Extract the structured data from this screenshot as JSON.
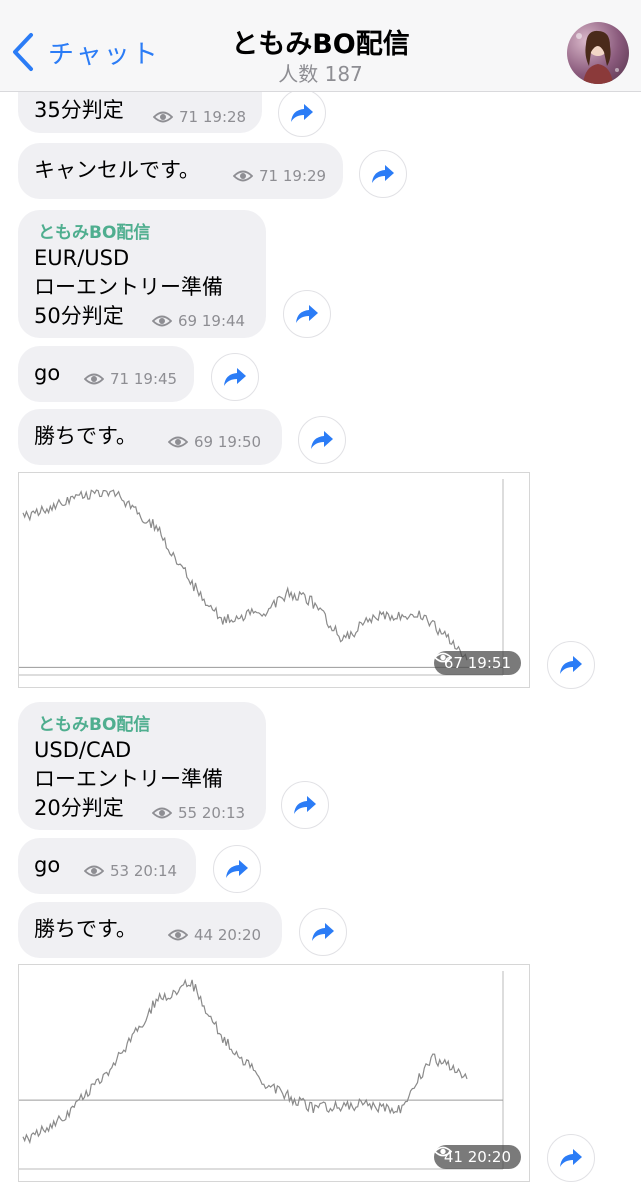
{
  "header": {
    "back_label": "チャット",
    "title": "ともみBO配信",
    "subtitle": "人数 187"
  },
  "messages": [
    {
      "text": "35分判定",
      "views": "71",
      "time": "19:28"
    },
    {
      "text": "キャンセルです。",
      "views": "71",
      "time": "19:29"
    },
    {
      "sender": "ともみBO配信",
      "text": "EUR/USD\nローエントリー準備\n50分判定",
      "views": "69",
      "time": "19:44"
    },
    {
      "text": "go",
      "views": "71",
      "time": "19:45"
    },
    {
      "text": "勝ちです。",
      "views": "69",
      "time": "19:50"
    },
    {
      "image": "price-chart",
      "views": "67",
      "time": "19:51"
    },
    {
      "sender": "ともみBO配信",
      "text": "USD/CAD\nローエントリー準備\n20分判定",
      "views": "55",
      "time": "20:13"
    },
    {
      "text": "go",
      "views": "53",
      "time": "20:14"
    },
    {
      "text": "勝ちです。",
      "views": "44",
      "time": "20:20"
    },
    {
      "image": "price-chart",
      "views": "41",
      "time": "20:20"
    }
  ],
  "colors": {
    "accent": "#2b7cf6",
    "sender_name": "#4fae8f",
    "bubble": "#f0f0f3",
    "meta": "#8e8e93"
  },
  "icons": [
    "back-chevron-icon",
    "eye-icon",
    "share-arrow-icon"
  ]
}
